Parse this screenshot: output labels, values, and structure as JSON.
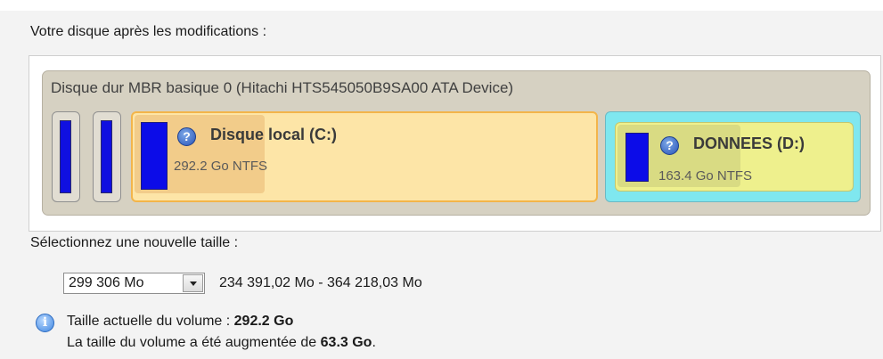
{
  "header": {
    "label": "Votre disque après les modifications :"
  },
  "disk": {
    "title": "Disque dur MBR basique 0 (Hitachi HTS545050B9SA00 ATA Device)",
    "partitions": [
      {
        "name": "Disque local (C:)",
        "info": "292.2 Go NTFS",
        "color": "#fde5a7"
      },
      {
        "name": "DONNEES (D:)",
        "info": "163.4 Go NTFS",
        "color": "#eef08d"
      }
    ]
  },
  "resize": {
    "label": "Sélectionnez une nouvelle taille :",
    "value": "299 306 Mo",
    "range": "234 391,02 Mo - 364 218,03 Mo"
  },
  "info": {
    "line1_prefix": "Taille actuelle du volume : ",
    "line1_value": "292.2 Go",
    "line2_prefix": "La taille du volume a été augmentée de ",
    "line2_value": "63.3 Go",
    "line2_suffix": "."
  },
  "icons": {
    "help": "help-icon",
    "info": "info-icon",
    "dropdown": "chevron-down-icon"
  }
}
